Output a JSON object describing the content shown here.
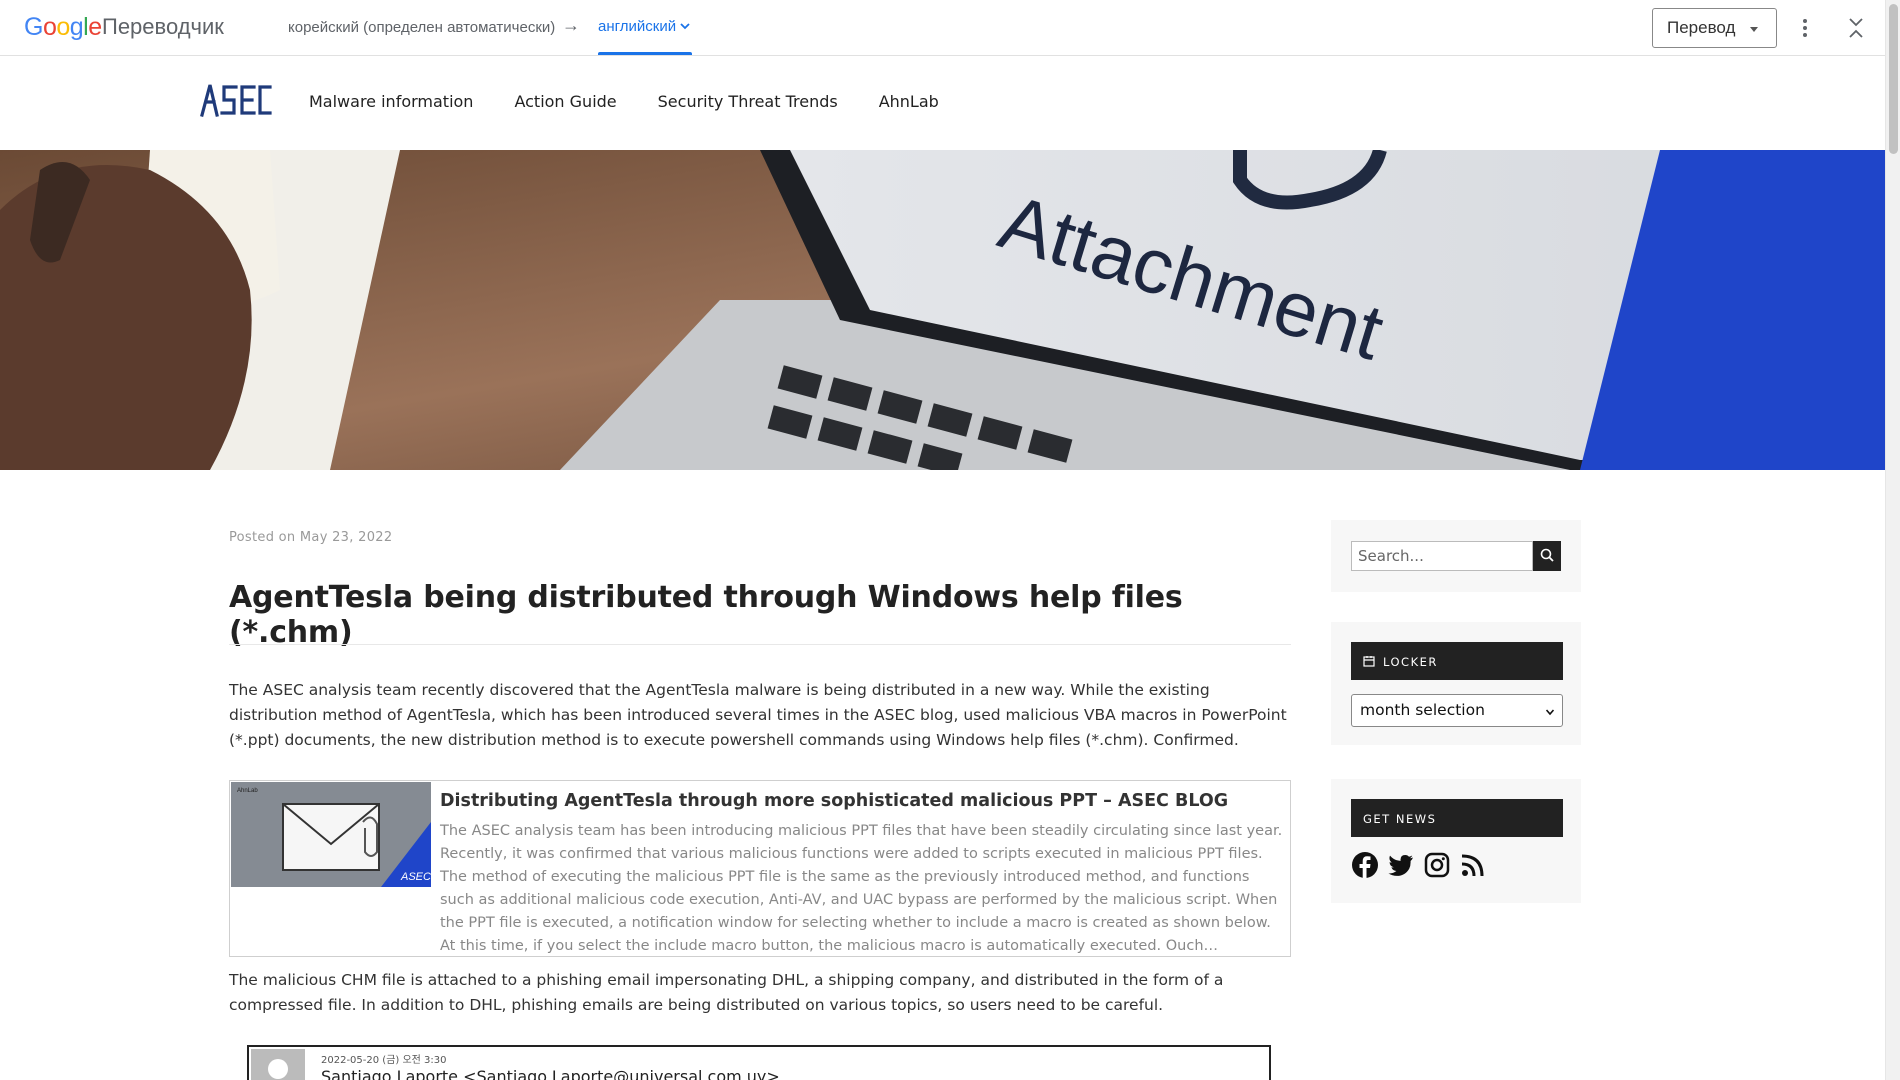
{
  "translate_bar": {
    "product": "Переводчик",
    "source_lang": "корейский (определен автоматически)",
    "arrow": "→",
    "target_lang": "английский",
    "translate_button": "Перевод"
  },
  "site": {
    "logo_text": "ASEC",
    "nav": [
      "Malware information",
      "Action Guide",
      "Security Threat Trends",
      "AhnLab"
    ]
  },
  "hero": {
    "caption_word": "Attachment",
    "accent_color": "#1f45c9"
  },
  "post": {
    "posted_on": "Posted on May 23, 2022",
    "title": "AgentTesla being distributed through Windows help files (*.chm)",
    "paragraph1": "The ASEC analysis team recently discovered that the AgentTesla malware is being distributed in a new way. While the existing distribution method of AgentTesla, which has been introduced several times in the ASEC blog, used malicious VBA macros in PowerPoint (*.ppt) documents, the new distribution method is to execute powershell commands using Windows help files (*.chm). Confirmed.",
    "embed": {
      "image_brand_small": "AhnLab",
      "image_brand": "ASEC",
      "title": "Distributing AgentTesla through more sophisticated malicious PPT – ASEC BLOG",
      "description": "The ASEC analysis team has been introducing malicious PPT files that have been steadily circulating since last year. Recently, it was confirmed that various malicious functions were added to scripts executed in malicious PPT files. The method of executing the malicious PPT file is the same as the previously introduced method, and functions such as additional malicious code execution, Anti-AV, and UAC bypass are performed by the malicious script. When the PPT file is executed, a notification window for selecting whether to include a macro is created as shown below. At this time, if you select the include macro button, the malicious macro is automatically executed. Ouch…"
    },
    "paragraph2": "The malicious CHM file is attached to a phishing email impersonating DHL, a shipping company, and distributed in the form of a compressed file. In addition to DHL, phishing emails are being distributed on various topics, so users need to be careful.",
    "email_screenshot": {
      "date": "2022-05-20 (금) 오전 3:30",
      "from": "Santiago Laporte <Santiago.Laporte@universal.com.uy>"
    }
  },
  "sidebar": {
    "search_placeholder": "Search...",
    "locker_title": "LOCKER",
    "month_select": "month selection",
    "news_title": "GET NEWS",
    "social_icons": [
      "facebook-icon",
      "twitter-icon",
      "instagram-icon",
      "rss-icon"
    ]
  }
}
